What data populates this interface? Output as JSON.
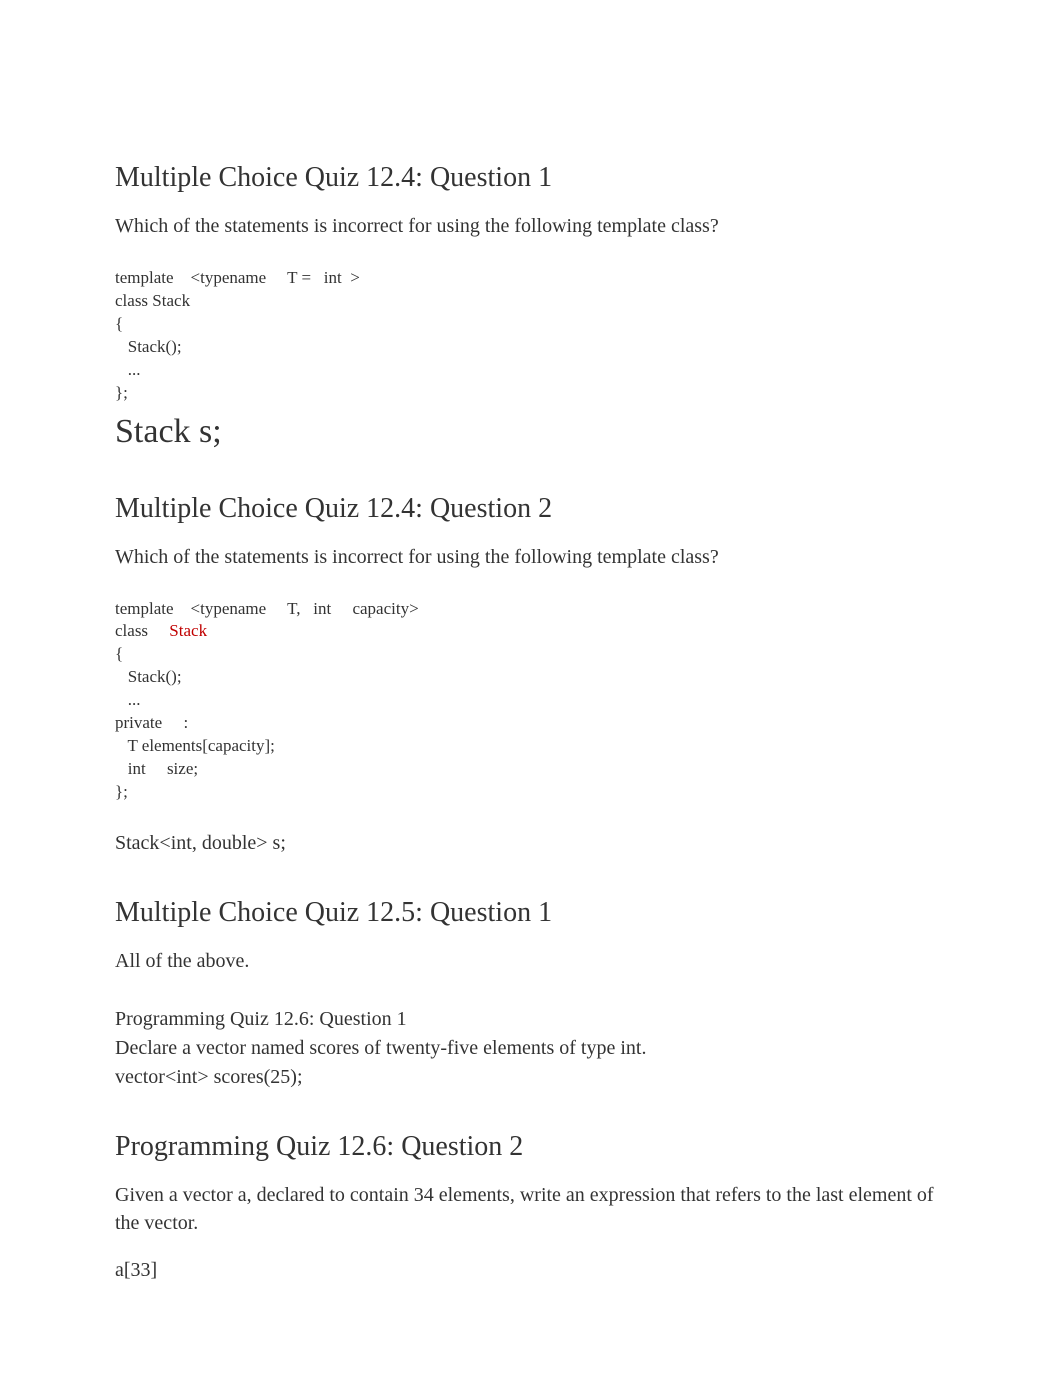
{
  "q1": {
    "heading": "Multiple Choice Quiz 12.4: Question 1",
    "prompt": "Which of the statements is incorrect for using the following template class?",
    "code_l1": "template    <typename     T =   int  >",
    "code_l2": "class Stack",
    "code_l3": "{",
    "code_l4": "   Stack();",
    "code_l5": "   ...",
    "code_l6": "};",
    "answer": "Stack s;"
  },
  "q2": {
    "heading": "Multiple Choice Quiz 12.4: Question 2",
    "prompt": "Which of the statements is incorrect for using the following template class?",
    "code_l1": "template    <typename     T,   int     capacity>",
    "code_l2a": "class     ",
    "code_l2b": "Stack",
    "code_l3": "{",
    "code_l4": "   Stack();",
    "code_l5": "   ...",
    "code_l6": "private     :",
    "code_l7": "   T elements[capacity];",
    "code_l8": "   int     size;",
    "code_l9": "};",
    "answer": "Stack<int, double> s;"
  },
  "q3": {
    "heading": "Multiple Choice Quiz 12.5: Question 1",
    "answer": "All of the above."
  },
  "q4": {
    "heading": "Programming Quiz 12.6: Question 1",
    "prompt": "Declare a vector named scores of twenty-five elements of type int.",
    "answer": "vector<int> scores(25);"
  },
  "q5": {
    "heading": "Programming Quiz 12.6: Question 2",
    "prompt": "Given a vector a, declared to contain 34 elements, write an expression that refers to the last element of the vector.",
    "answer": "a[33]"
  }
}
